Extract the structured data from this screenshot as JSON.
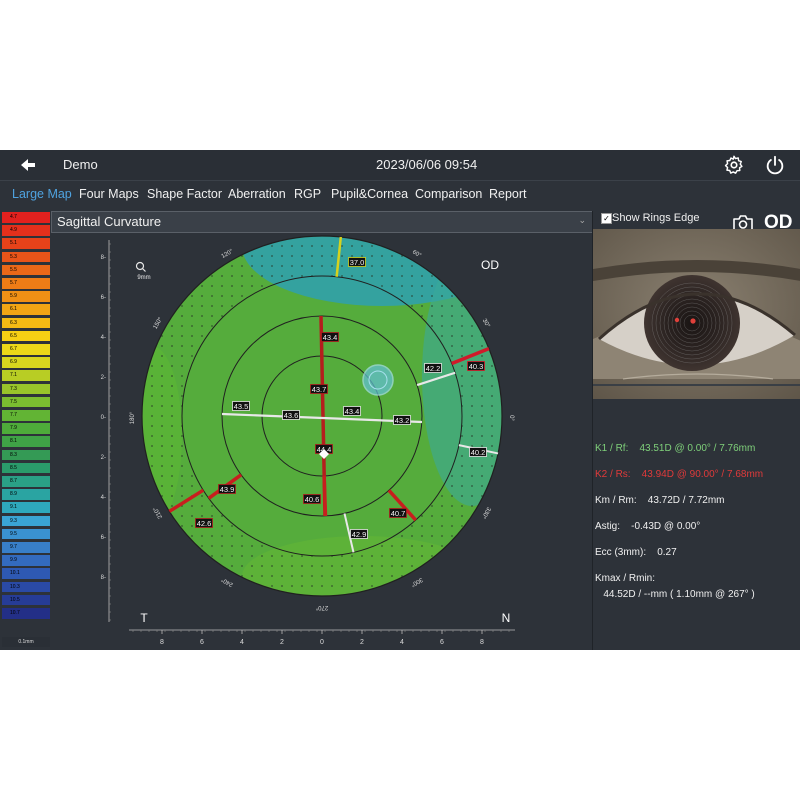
{
  "header": {
    "patient": "Demo",
    "datetime": "2023/06/06 09:54"
  },
  "tabs": [
    {
      "label": "Large Map",
      "active": true
    },
    {
      "label": "Four Maps"
    },
    {
      "label": "Shape Factor"
    },
    {
      "label": "Aberration"
    },
    {
      "label": "RGP"
    },
    {
      "label": "Pupil&Cornea"
    },
    {
      "label": "Comparison"
    },
    {
      "label": "Report"
    }
  ],
  "eye": "OD",
  "scale": {
    "labels": [
      "4.7",
      "4.9",
      "5.1",
      "5.3",
      "5.5",
      "5.7",
      "5.9",
      "6.1",
      "6.3",
      "6.5",
      "6.7",
      "6.9",
      "7.1",
      "7.3",
      "7.5",
      "7.7",
      "7.9",
      "8.1",
      "8.3",
      "8.5",
      "8.7",
      "8.9",
      "9.1",
      "9.3",
      "9.5",
      "9.7",
      "9.9",
      "10.1",
      "10.3",
      "10.5",
      "10.7"
    ],
    "colors": [
      "#e2211e",
      "#e4301c",
      "#e6421a",
      "#e95419",
      "#eb6818",
      "#ee7c16",
      "#f09015",
      "#f2a514",
      "#f4ba14",
      "#f6cf14",
      "#ecd818",
      "#d8d61e",
      "#b8cd24",
      "#98c42a",
      "#7bbc30",
      "#62b434",
      "#4eab3a",
      "#3fa246",
      "#349a55",
      "#2a9b6b",
      "#2aa086",
      "#2aa4a2",
      "#2ea8bd",
      "#3aa4d4",
      "#3a92d1",
      "#387fc9",
      "#336bbf",
      "#2e59b3",
      "#2a4aa5",
      "#263c96",
      "#232f87"
    ],
    "unit": "0.1mm"
  },
  "map": {
    "title": "Sagittal Curvature",
    "zoom_label": "9mm",
    "eye_label": "OD",
    "temporal_label": "T",
    "nasal_label": "N",
    "axis_angles": [
      "90°",
      "60°",
      "30°",
      "0°",
      "330°",
      "300°",
      "270°",
      "240°",
      "210°",
      "180°",
      "150°",
      "120°"
    ],
    "x_ticks": [
      "8",
      "6",
      "4",
      "2",
      "0",
      "2",
      "4",
      "6",
      "8"
    ],
    "y_ticks": [
      "8-",
      "6-",
      "4-",
      "2-",
      "0-",
      "2-",
      "4-",
      "6-",
      "8-"
    ],
    "readings": [
      {
        "value": "37.0",
        "color": "#d4d11e"
      },
      {
        "value": "43.4",
        "color": "#b01e1e"
      },
      {
        "value": "42.2",
        "color": "#e8e8e8"
      },
      {
        "value": "40.3",
        "color": "#d8182a"
      },
      {
        "value": "43.5",
        "color": "#e8e8e8"
      },
      {
        "value": "43.6",
        "color": "#e8e8e8"
      },
      {
        "value": "43.4",
        "color": "#e8e8e8"
      },
      {
        "value": "43.2",
        "color": "#e8e8e8"
      },
      {
        "value": "43.7",
        "color": "#b01e1e"
      },
      {
        "value": "44.4",
        "color": "#b01e1e"
      },
      {
        "value": "40.2",
        "color": "#e8e8e8"
      },
      {
        "value": "43.9",
        "color": "#b01e1e"
      },
      {
        "value": "40.6",
        "color": "#b01e1e"
      },
      {
        "value": "40.7",
        "color": "#b01e1e"
      },
      {
        "value": "42.6",
        "color": "#b01e1e"
      },
      {
        "value": "42.9",
        "color": "#e8e8e8"
      }
    ]
  },
  "right_panel": {
    "show_rings_edge_label": "Show Rings Edge",
    "show_rings_edge_checked": true,
    "k1": {
      "text": "K1 / Rf:    43.51D @ 0.00° / 7.76mm",
      "color": "#7fd07a"
    },
    "k2": {
      "text": "K2 / Rs:    43.94D @ 90.00° / 7.68mm",
      "color": "#e03a3a"
    },
    "km": {
      "text": "Km / Rm:    43.72D / 7.72mm"
    },
    "astig": {
      "text": "Astig:    -0.43D @ 0.00°"
    },
    "ecc": {
      "text": "Ecc (3mm):    0.27"
    },
    "kmax_label": {
      "text": "Kmax / Rmin:"
    },
    "kmax_value": {
      "text": "   44.52D / --mm ( 1.10mm @ 267° )"
    }
  }
}
